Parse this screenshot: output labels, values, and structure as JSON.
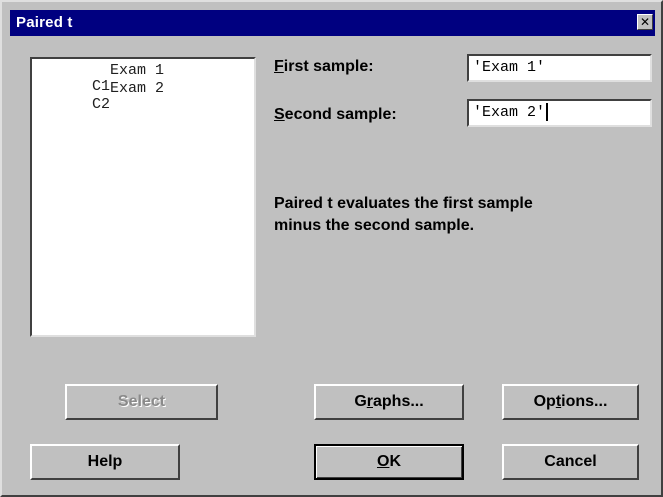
{
  "window": {
    "title": "Paired t",
    "close_glyph": "✕"
  },
  "variables": [
    {
      "column": "C1",
      "name": "Exam 1"
    },
    {
      "column": "C2",
      "name": "Exam 2"
    }
  ],
  "first_sample": {
    "label_mnemonic": "F",
    "label_rest": "irst sample:",
    "value": "'Exam 1'"
  },
  "second_sample": {
    "label_mnemonic": "S",
    "label_rest": "econd sample:",
    "value": "'Exam 2'"
  },
  "description": {
    "line1": "Paired t evaluates the first sample",
    "line2": "minus the second sample."
  },
  "buttons": {
    "select": {
      "label": "Select",
      "enabled": false
    },
    "graphs": {
      "pre": "G",
      "mnemonic": "r",
      "post": "aphs..."
    },
    "options": {
      "pre": "Op",
      "mnemonic": "t",
      "post": "ions..."
    },
    "help": {
      "label": "Help"
    },
    "ok": {
      "mnemonic": "O",
      "post": "K"
    },
    "cancel": {
      "label": "Cancel"
    }
  },
  "colors": {
    "face": "#c0c0c0",
    "titlebar": "#000080",
    "title_text": "#ffffff",
    "disabled_text": "#8a8a8a"
  },
  "icons": {
    "close": "close-icon"
  }
}
